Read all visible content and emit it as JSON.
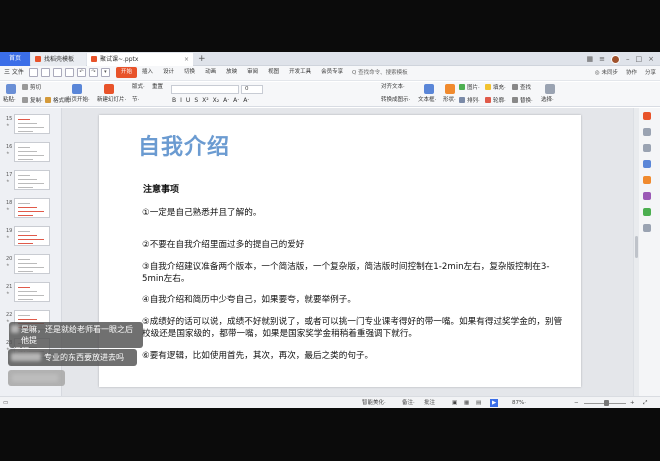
{
  "tabs": {
    "home": "首页",
    "doc1": "找稻壳模板",
    "doc2": "聚试课~.pptx",
    "add": "+"
  },
  "menubar": {
    "file": "三 文件",
    "items": [
      "开始",
      "插入",
      "设计",
      "切换",
      "动画",
      "放映",
      "审阅",
      "视图",
      "开发工具",
      "会员专享"
    ],
    "active_index": 0,
    "search": "Q 查找命令、搜索模板",
    "right": [
      "◎ 未同步",
      "协作",
      "分享"
    ]
  },
  "ribbon": {
    "paste": "粘贴·",
    "cut": "剪切",
    "copy": "复制·",
    "format_painter": "格式刷",
    "from_start": "当页开始·",
    "new_slide": "新建幻灯片·",
    "layout": "版式·",
    "section": "节·",
    "reset": "重置",
    "font_placeholder": "",
    "size_placeholder": "0",
    "fmt_buttons": [
      "B",
      "I",
      "U",
      "S",
      "X²",
      "X₂",
      "A·",
      "A·",
      "A·"
    ],
    "align_text": "对齐文本·",
    "convert_smartart": "转换成图示·",
    "text_box": "文本框·",
    "shape": "形状·",
    "arrange": "排列·",
    "picture": "图片·",
    "fill": "填充·",
    "outline": "轮廓·",
    "find": "查找",
    "replace": "替换·",
    "select": "选择·"
  },
  "thumbnails": [
    "15",
    "16",
    "17",
    "18",
    "19",
    "20",
    "21",
    "22",
    "23"
  ],
  "slide": {
    "title": "自我介绍",
    "heading": "注意事项",
    "items": [
      "①一定是自己熟悉并且了解的。",
      "②不要在自我介绍里面过多的提自己的爱好",
      "③自我介绍建议准备两个版本，一个简洁版，一个复杂版，简洁版时间控制在1-2min左右，复杂版控制在3-5min左右。",
      "④自我介绍和简历中少夸自己，如果要夸，就要举例子。",
      "⑤成绩好的话可以说，成绩不好就别说了，或者可以挑一门专业课考得好的带一嘴。如果有得过奖学金的，别管校级还是国家级的，都带一嘴，如果是国家奖学金稍稍着重强调下就行。",
      "⑥要有逻辑，比如使用首先，其次，再次，最后之类的句子。"
    ]
  },
  "statusbar": {
    "smart_beautify": "智能美化·",
    "notes": "备注·",
    "comments": "批注",
    "zoom": "87%·",
    "zoom_value": 0.5
  },
  "chat": {
    "msg1_line1": "是嘛，还是就给老师看一眼之后他提",
    "msg1_line2": "问题",
    "msg2": "专业的东西要放进去吗",
    "msg3": ""
  },
  "colors": {
    "accent": "#e8532a",
    "home_tab": "#3b6ee8",
    "title_blue": "#6b9bd1"
  }
}
